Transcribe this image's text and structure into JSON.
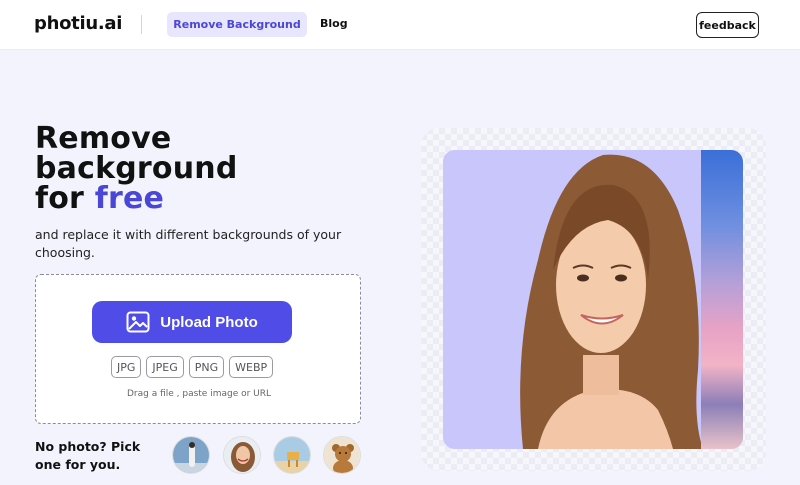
{
  "header": {
    "logo": "photiu.ai",
    "nav_active": "Remove Background",
    "nav_blog": "Blog",
    "feedback": "feedback"
  },
  "hero": {
    "title_line1": "Remove",
    "title_line2": "background",
    "title_line3_prefix": "for ",
    "title_line3_accent": "free",
    "subtitle": "and replace it with different backgrounds of your choosing."
  },
  "upload": {
    "button_label": "Upload Photo",
    "formats": [
      "JPG",
      "JPEG",
      "PNG",
      "WEBP"
    ],
    "hint": "Drag a file , paste image or URL"
  },
  "samples": {
    "label": "No photo? Pick one for you."
  },
  "colors": {
    "accent": "#4b47d6",
    "button": "#4f4ce8",
    "preview_bg": "#c9c6fb"
  }
}
